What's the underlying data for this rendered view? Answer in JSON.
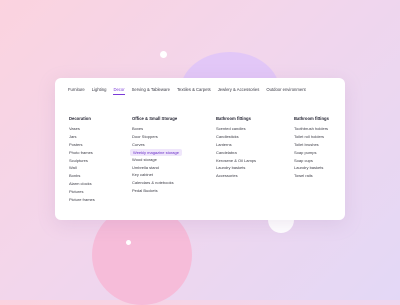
{
  "tabs": [
    "Furniture",
    "Lighting",
    "Decor",
    "Serving & Tableware",
    "Textiles & Carpets",
    "Jewlery & Accessories",
    "Outdoor environment"
  ],
  "active_tab": "Decor",
  "columns": [
    {
      "title": "Decoration",
      "items": [
        "Vases",
        "Jars",
        "Posters",
        "Photo frames",
        "Sculptures",
        "Wall",
        "Bonbs",
        "Alarm clocks",
        "Pictures",
        "Picture frames"
      ]
    },
    {
      "title": "Office & Small Storage",
      "items": [
        "Boxes",
        "Door Stoppers",
        "Curves",
        "Weekly magazine storage",
        "Wood storage",
        "Umbrella stand",
        "Key cabinet",
        "Calendars & notebooks",
        "Pedal Buckets"
      ],
      "highlighted": "Weekly magazine storage"
    },
    {
      "title": "Bathroom fittings",
      "items": [
        "Scented candles",
        "Candlesticks",
        "Lanterns",
        "Candelabra",
        "Kerosene & Oil Lamps",
        "Laundry baskets",
        "Accessories"
      ]
    },
    {
      "title": "Bathroom fittings",
      "items": [
        "Toothbrush holders",
        "Toilet roll holders",
        "Toilet brushes",
        "Soap pumps",
        "Soap cups",
        "Laundry baskets",
        "Towel rails"
      ]
    }
  ],
  "colors": {
    "accent": "#7b3ad8",
    "highlight_bg": "#efe6fb",
    "panel": "#ffffff"
  }
}
